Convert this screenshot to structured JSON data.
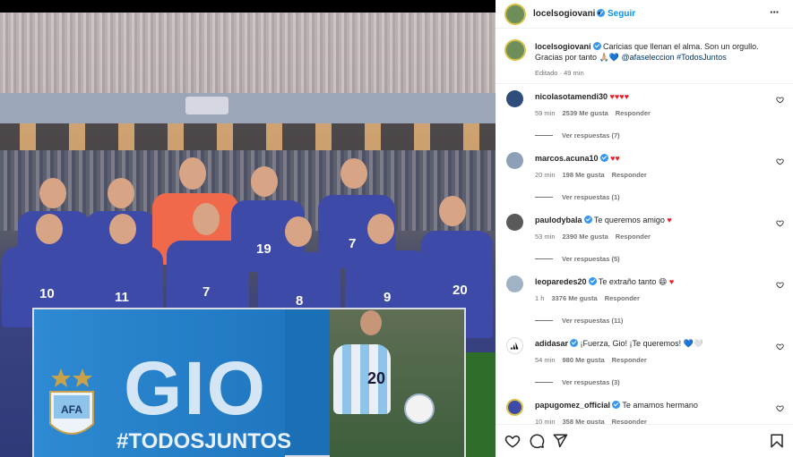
{
  "post": {
    "author": "locelsogiovani",
    "follow_label": "Seguir",
    "separator": "•",
    "more_label": "···",
    "caption_text": "Caricias que llenan el alma. Son un orgullo. Gracias por tanto 🙏🏼💙",
    "caption_mention": "@afaseleccion",
    "caption_hashtag": "#TodosJuntos",
    "edited_label": "Editado · 49 min"
  },
  "photo": {
    "banner_title": "GIO",
    "banner_hashtag": "#TODOSJUNTOS",
    "shirt_numbers": [
      "10",
      "11",
      "7",
      "8",
      "9",
      "20",
      "19",
      "7"
    ],
    "gio_number": "20"
  },
  "comments": [
    {
      "user": "nicolasotamendi30",
      "text": "",
      "hearts": "♥♥♥♥",
      "time": "59 min",
      "likes": "2539 Me gusta",
      "reply": "Responder",
      "replies": "Ver respuestas (7)"
    },
    {
      "user": "marcos.acuna10",
      "text": "",
      "hearts": "♥♥",
      "time": "20 min",
      "likes": "198 Me gusta",
      "reply": "Responder",
      "replies": "Ver respuestas (1)"
    },
    {
      "user": "paulodybala",
      "text": "Te queremos amigo",
      "hearts": "♥",
      "time": "53 min",
      "likes": "2390 Me gusta",
      "reply": "Responder",
      "replies": "Ver respuestas (5)"
    },
    {
      "user": "leoparedes20",
      "text": "Te extraño tanto 😄",
      "hearts": "♥",
      "time": "1 h",
      "likes": "3376 Me gusta",
      "reply": "Responder",
      "replies": "Ver respuestas (11)"
    },
    {
      "user": "adidasar",
      "text": "¡Fuerza, Gio! ¡Te queremos! 💙🤍",
      "hearts": "",
      "time": "54 min",
      "likes": "980 Me gusta",
      "reply": "Responder",
      "replies": "Ver respuestas (3)"
    },
    {
      "user": "papugomez_official",
      "text": "Te amamos hermano",
      "hearts": "",
      "time": "10 min",
      "likes": "358 Me gusta",
      "reply": "Responder",
      "replies": ""
    }
  ],
  "icons": {
    "like": "heart-icon",
    "comment": "comment-icon",
    "share": "share-icon",
    "save": "bookmark-icon"
  },
  "colors": {
    "accent": "#0095f6",
    "verified": "#3797f0",
    "link": "#00376b",
    "heart": "#ed1c24",
    "muted": "#737373"
  }
}
